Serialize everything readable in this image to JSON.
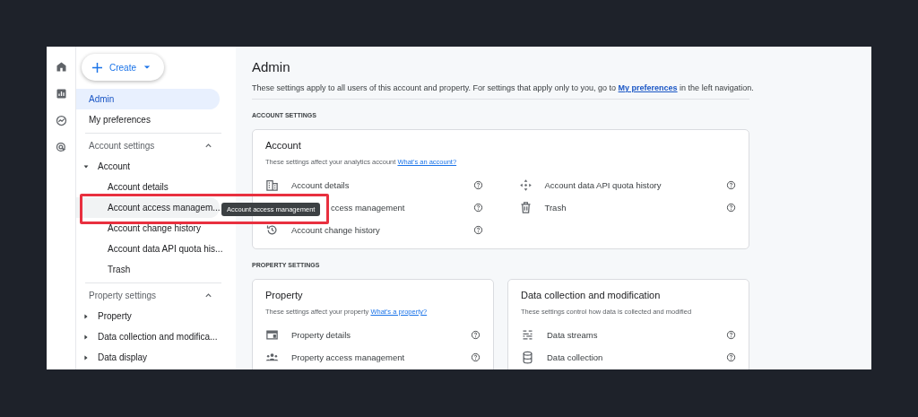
{
  "rail": [
    {
      "kind": "home"
    },
    {
      "kind": "reports"
    },
    {
      "kind": "explore"
    },
    {
      "kind": "advertising"
    }
  ],
  "create_button": {
    "label": "Create"
  },
  "nav": {
    "items": [
      {
        "label": "Admin",
        "selected": true
      },
      {
        "label": "My preferences",
        "selected": false
      }
    ],
    "sections": [
      {
        "title": "Account settings",
        "expanded": true,
        "groups": [
          {
            "label": "Account",
            "expanded": true,
            "children": [
              {
                "label": "Account details",
                "hovered": false
              },
              {
                "label": "Account access managem...",
                "hovered": true
              },
              {
                "label": "Account change history",
                "hovered": false
              },
              {
                "label": "Account data API quota his...",
                "hovered": false
              },
              {
                "label": "Trash",
                "hovered": false
              }
            ]
          }
        ]
      },
      {
        "title": "Property settings",
        "expanded": true,
        "groups": [
          {
            "label": "Property",
            "expanded": false
          },
          {
            "label": "Data collection and modifica...",
            "expanded": false
          },
          {
            "label": "Data display",
            "expanded": false
          }
        ]
      }
    ]
  },
  "tooltip": {
    "text": "Account access management"
  },
  "main": {
    "title": "Admin",
    "intro_before": "These settings apply to all users of this account and property. For settings that apply only to you, go to ",
    "intro_link": "My preferences",
    "intro_after": " in the left navigation.",
    "sections": [
      {
        "heading": "ACCOUNT SETTINGS",
        "cards": [
          {
            "title": "Account",
            "description": "These settings affect your analytics account",
            "link": "What's an account?",
            "columns": [
              [
                {
                  "kind": "building",
                  "label": "Account details"
                },
                {
                  "kind": "covered",
                  "label": "ccess management"
                },
                {
                  "kind": "history",
                  "label": "Account change history"
                }
              ],
              [
                {
                  "kind": "arrows",
                  "label": "Account data API quota history"
                },
                {
                  "kind": "trash",
                  "label": "Trash"
                }
              ]
            ]
          }
        ]
      },
      {
        "heading": "PROPERTY SETTINGS",
        "cards": [
          {
            "title": "Property",
            "description": "These settings affect your property",
            "link": "What's a property?",
            "columns": [
              [
                {
                  "kind": "panel",
                  "label": "Property details"
                },
                {
                  "kind": "people",
                  "label": "Property access management"
                }
              ]
            ]
          },
          {
            "title": "Data collection and modification",
            "description": "These settings control how data is collected and modified",
            "columns": [
              [
                {
                  "kind": "streams",
                  "label": "Data streams"
                },
                {
                  "kind": "database",
                  "label": "Data collection"
                }
              ]
            ]
          }
        ]
      }
    ]
  }
}
